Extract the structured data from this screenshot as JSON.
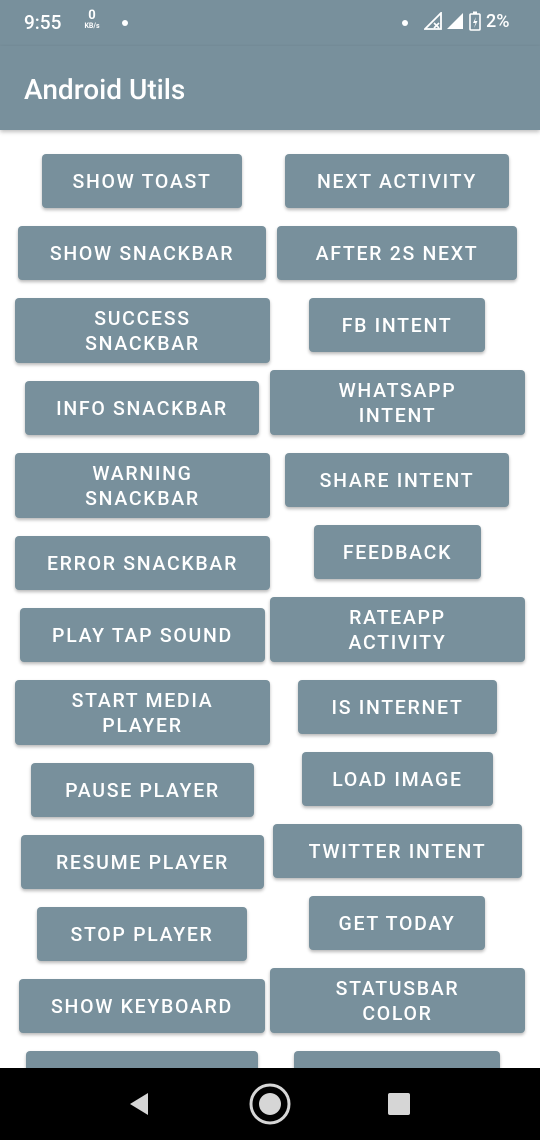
{
  "statusbar": {
    "time": "9:55",
    "speed_value": "0",
    "speed_unit": "KB/s",
    "battery": "2%"
  },
  "appbar": {
    "title": "Android Utils"
  },
  "buttons": {
    "show_toast": "SHOW TOAST",
    "next_activity": "NEXT ACTIVITY",
    "show_snackbar": "SHOW SNACKBAR",
    "after_2s_next": "AFTER 2S NEXT",
    "success_snackbar": "SUCCESS\nSNACKBAR",
    "fb_intent": "FB INTENT",
    "info_snackbar": "INFO SNACKBAR",
    "whatsapp_intent": "WHATSAPP\nINTENT",
    "warning_snackbar": "WARNING\nSNACKBAR",
    "share_intent": "SHARE INTENT",
    "error_snackbar": "ERROR SNACKBAR",
    "feedback": "FEEDBACK",
    "play_tap_sound": "PLAY TAP SOUND",
    "rateapp_activity": "RATEAPP\nACTIVITY",
    "start_media_player": "START MEDIA\nPLAYER",
    "is_internet": "IS INTERNET",
    "pause_player": "PAUSE  PLAYER",
    "load_image": "LOAD IMAGE",
    "resume_player": "RESUME  PLAYER",
    "twitter_intent": "TWITTER INTENT",
    "stop_player": "STOP  PLAYER",
    "get_today": "GET TODAY",
    "show_keyboard": "SHOW KEYBOARD",
    "statusbar_color": "STATUSBAR\nCOLOR"
  },
  "colors": {
    "primary": "#78909c",
    "background": "#ffffff",
    "navbar": "#000000"
  }
}
